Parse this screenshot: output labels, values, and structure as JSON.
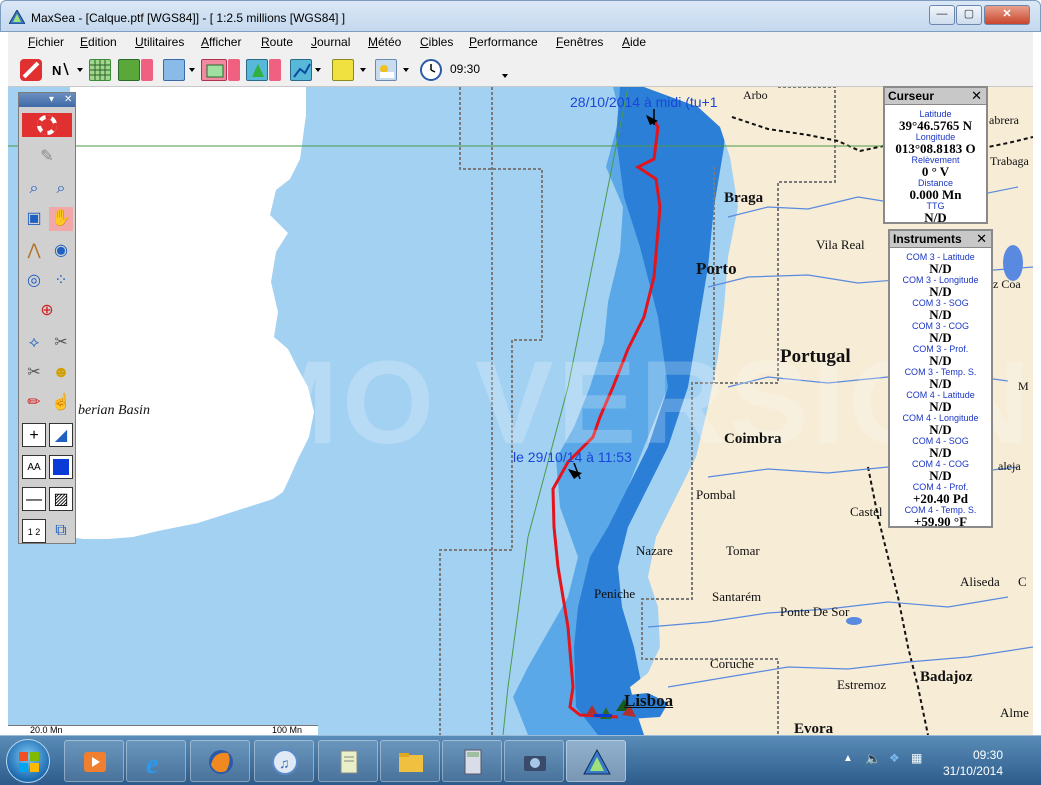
{
  "window": {
    "title": "MaxSea - [Calque.ptf [WGS84]] - [ 1:2.5 millions [WGS84] ]",
    "buttons": {
      "minimize": "—",
      "maximize": "▢",
      "close": "✕"
    }
  },
  "menu": [
    "Fichier",
    "Edition",
    "Utilitaires",
    "Afficher",
    "Route",
    "Journal",
    "Météo",
    "Cibles",
    "Performance",
    "Fenêtres",
    "Aide"
  ],
  "toolbar": {
    "time": "09:30"
  },
  "map": {
    "watermark": "DEMO VERSION",
    "route_labels": [
      "28/10/2014 à midi (tu+1",
      "le 29/10/14 à 11:53"
    ],
    "places": {
      "arbo": "Arbo",
      "abrera": "abrera",
      "trabaga": "Trabaga",
      "braga": "Braga",
      "vila_real": "Vila Real",
      "porto": "Porto",
      "portugal": "Portugal",
      "coimbra": "Coimbra",
      "pombal": "Pombal",
      "nazare": "Nazare",
      "tomar": "Tomar",
      "peniche": "Peniche",
      "santarem": "Santarém",
      "ponte_de_sor": "Ponte De Sor",
      "coruche": "Coruche",
      "lisboa": "Lisboa",
      "estremoz": "Estremoz",
      "badajoz": "Badajoz",
      "evora": "Evora",
      "castel": "Castel",
      "aliseda": "Aliseda",
      "c_right": "C",
      "almer": "Alme",
      "ejala": "aleja",
      "m_right": "M",
      "z_coa": "z Coa",
      "basin": "berian Basin"
    },
    "scale": {
      "left": "20.0 Mn",
      "right": "100 Mn"
    }
  },
  "panels": {
    "curseur": {
      "title": "Curseur",
      "rows": [
        {
          "label": "Latitude",
          "value": "39°46.5765 N"
        },
        {
          "label": "Longitude",
          "value": "013°08.8183 O"
        },
        {
          "label": "Relèvement",
          "value": "0 ° V"
        },
        {
          "label": "Distance",
          "value": "0.000 Mn"
        },
        {
          "label": "TTG",
          "value": "N/D"
        }
      ]
    },
    "instruments": {
      "title": "Instruments",
      "rows": [
        {
          "label": "COM 3 - Latitude",
          "value": "N/D"
        },
        {
          "label": "COM 3 - Longitude",
          "value": "N/D"
        },
        {
          "label": "COM 3 - SOG",
          "value": "N/D"
        },
        {
          "label": "COM 3 - COG",
          "value": "N/D"
        },
        {
          "label": "COM 3 - Prof.",
          "value": "N/D"
        },
        {
          "label": "COM 3 - Temp. S.",
          "value": "N/D"
        },
        {
          "label": "COM 4 - Latitude",
          "value": "N/D"
        },
        {
          "label": "COM 4 - Longitude",
          "value": "N/D"
        },
        {
          "label": "COM 4 - SOG",
          "value": "N/D"
        },
        {
          "label": "COM 4 - COG",
          "value": "N/D"
        },
        {
          "label": "COM 4 - Prof.",
          "value": "+20.40 Pd"
        },
        {
          "label": "COM 4 - Temp. S.",
          "value": "+59.90 °F"
        }
      ]
    }
  },
  "taskbar": {
    "time": "09:30",
    "date": "31/10/2014"
  },
  "colors": {
    "sea": "#a3d1f2",
    "shallow": "#5aa8e8",
    "deep": "#2b7fd6",
    "land": "#f7ecd6",
    "route": "#e4141c"
  }
}
